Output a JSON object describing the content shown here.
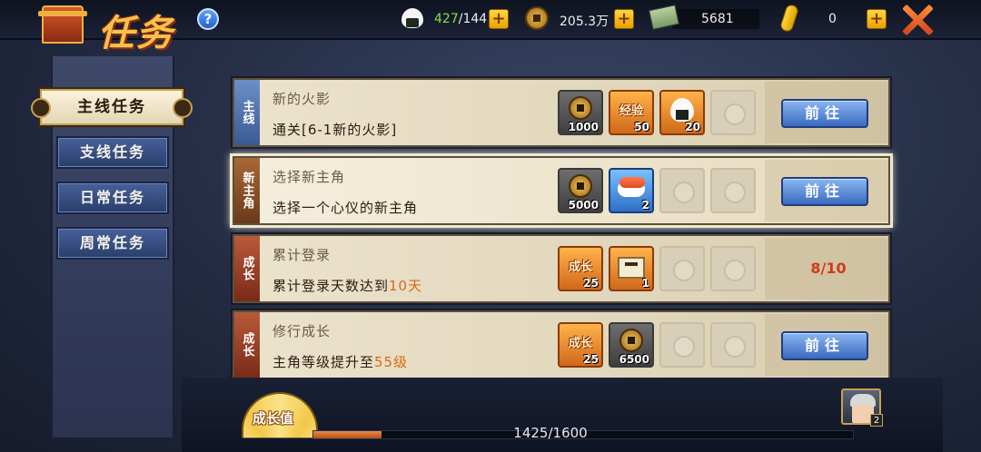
{
  "header": {
    "title": "任务",
    "help_glyph": "?",
    "resources": {
      "stamina_current": "427",
      "stamina_max": "/144",
      "coins": "205.3万",
      "cash": "5681",
      "gold": "0"
    },
    "plus_glyph": "+"
  },
  "sidebar": {
    "items": [
      {
        "label": "主线任务",
        "active": true
      },
      {
        "label": "支线任务",
        "active": false
      },
      {
        "label": "日常任务",
        "active": false
      },
      {
        "label": "周常任务",
        "active": false
      }
    ]
  },
  "tasks": [
    {
      "tag": "主线",
      "title": "新的火影",
      "desc": "通关[6-1新的火影]",
      "rewards": [
        {
          "icon": "coin-icon",
          "count": "1000"
        },
        {
          "icon": "exp-icon",
          "label": "经验",
          "count": "50"
        },
        {
          "icon": "rice-ball-icon",
          "count": "20"
        }
      ],
      "button": "前往"
    },
    {
      "tag": "新主角",
      "title": "选择新主角",
      "desc": "选择一个心仪的新主角",
      "rewards": [
        {
          "icon": "coin-icon",
          "count": "5000"
        },
        {
          "icon": "sushi-icon",
          "count": "2"
        }
      ],
      "button": "前往"
    },
    {
      "tag": "成长",
      "title": "累计登录",
      "desc_prefix": "累计登录天数达到",
      "desc_highlight": "10天",
      "rewards": [
        {
          "icon": "growth-icon",
          "label": "成长",
          "count": "25"
        },
        {
          "icon": "scroll-icon",
          "count": "1"
        }
      ],
      "progress": "8/10"
    },
    {
      "tag": "成长",
      "title": "修行成长",
      "desc_prefix": "主角等级提升至",
      "desc_highlight": "55级",
      "rewards": [
        {
          "icon": "growth-icon",
          "label": "成长",
          "count": "25"
        },
        {
          "icon": "coin-icon",
          "count": "6500"
        }
      ],
      "button": "前往"
    }
  ],
  "footer": {
    "growth_label": "成长值",
    "progress_text": "1425/1600",
    "progress_fraction": 0.1263,
    "avatar_badge": "2"
  },
  "colors": {
    "accent_orange": "#d86a18",
    "progress_red": "#d03a1a",
    "button_blue": "#3a6ac0"
  }
}
